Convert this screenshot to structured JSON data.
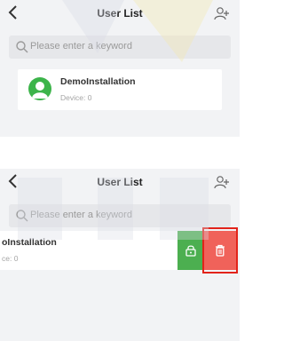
{
  "screen_top": {
    "header": {
      "title": "User List",
      "back_icon": "chevron-left-icon",
      "add_icon": "add-user-icon"
    },
    "search": {
      "placeholder": "Please enter a keyword",
      "icon": "search-icon"
    },
    "user": {
      "name": "DemoInstallation",
      "device": "Device: 0",
      "avatar_icon": "user-avatar-icon"
    }
  },
  "screen_bottom": {
    "header": {
      "title": "User List",
      "back_icon": "chevron-left-icon",
      "add_icon": "add-user-icon"
    },
    "search": {
      "placeholder": "Please enter a keyword",
      "icon": "search-icon"
    },
    "user": {
      "name_partial": "oInstallation",
      "device_partial": "ce: 0"
    },
    "actions": {
      "lock_icon": "lock-icon",
      "delete_icon": "trash-icon"
    }
  },
  "colors": {
    "accent_green": "#4caf50",
    "delete_red": "#f0625a",
    "highlight": "#e2231a"
  }
}
